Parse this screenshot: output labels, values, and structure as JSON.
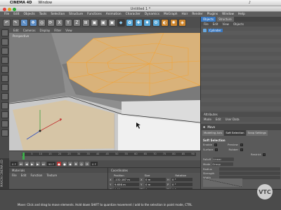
{
  "mac": {
    "apple": "",
    "app": "CINEMA 4D",
    "menus": [
      "Window"
    ],
    "status": [
      "",
      "",
      "♪",
      "",
      "",
      ""
    ]
  },
  "window": {
    "title": "Untitled 1 *"
  },
  "menu": [
    "File",
    "Edit",
    "Objects",
    "Tools",
    "Selection",
    "Structure",
    "Functions",
    "Animation",
    "Character",
    "Dynamics",
    "MoGraph",
    "Hair",
    "Render",
    "Plugins",
    "Window",
    "Help"
  ],
  "toolbar": [
    "↶",
    "↷",
    "↖",
    "✥",
    "◎",
    "⟳",
    "X",
    "Y",
    "Z",
    "⊞",
    "▣",
    "▣",
    "▣",
    "◆",
    "✿",
    "✚",
    "✸",
    "⚙",
    "◐",
    "✺",
    "◈"
  ],
  "viewport": {
    "menu": [
      "Edit",
      "Cameras",
      "Display",
      "Filter",
      "View"
    ],
    "label": "Perspective"
  },
  "timeline": {
    "ticks": [
      "0",
      "5",
      "10",
      "15",
      "20",
      "25",
      "30",
      "35",
      "40",
      "45",
      "50",
      "55",
      "60",
      "65",
      "70",
      "75",
      "80",
      "85",
      "90"
    ],
    "start": "0 F",
    "end": "90 F",
    "current": "0 F"
  },
  "objects": {
    "tabs": [
      "Objects",
      "Structure"
    ],
    "menu": [
      "File",
      "Edit",
      "View",
      "Objects"
    ],
    "item": "Cylinder"
  },
  "attributes": {
    "header": "Attributes",
    "menu": [
      "Mode",
      "Edit",
      "User Data"
    ],
    "tool": "Move",
    "tabs": [
      "Modeling Axis",
      "Soft Selection",
      "Snap Settings"
    ],
    "section": "Soft Selection",
    "rows": [
      {
        "label": "Enable",
        "label2": "Preview"
      },
      {
        "label": "Surface",
        "label2": "Rubber"
      },
      {
        "label": "Restrict"
      },
      {
        "label": "Falloff",
        "val": "Linear"
      },
      {
        "label": "Mode",
        "val": "Group"
      },
      {
        "label": "Radius"
      },
      {
        "label": "Strength"
      },
      {
        "label": "Width"
      }
    ]
  },
  "materials": {
    "header": "Materials",
    "menu": [
      "File",
      "Edit",
      "Function",
      "Texture"
    ]
  },
  "coords": {
    "header": "Coordinates",
    "cols": [
      "Position",
      "Size",
      "Rotation"
    ],
    "rows": [
      {
        "a": "X",
        "p": "-132.187 m",
        "b": "X",
        "s": "0 m",
        "c": "H",
        "r": "0 °"
      },
      {
        "a": "Y",
        "p": "9.656 m",
        "b": "Y",
        "s": "0 m",
        "c": "P",
        "r": "0 °"
      },
      {
        "a": "Z",
        "p": "0.56 m",
        "b": "Z",
        "s": "0 m",
        "c": "B",
        "r": "0 °"
      }
    ],
    "mode": "Object",
    "sizemode": "Size",
    "apply": "Apply"
  },
  "status": {
    "text": "Move: Click and drag to move elements. Hold down SHIFT to quantize movement / add to the selection in point mode, CTRL"
  },
  "brand": {
    "side": "MAXON CINEMA 4D",
    "badge": "VTC"
  }
}
